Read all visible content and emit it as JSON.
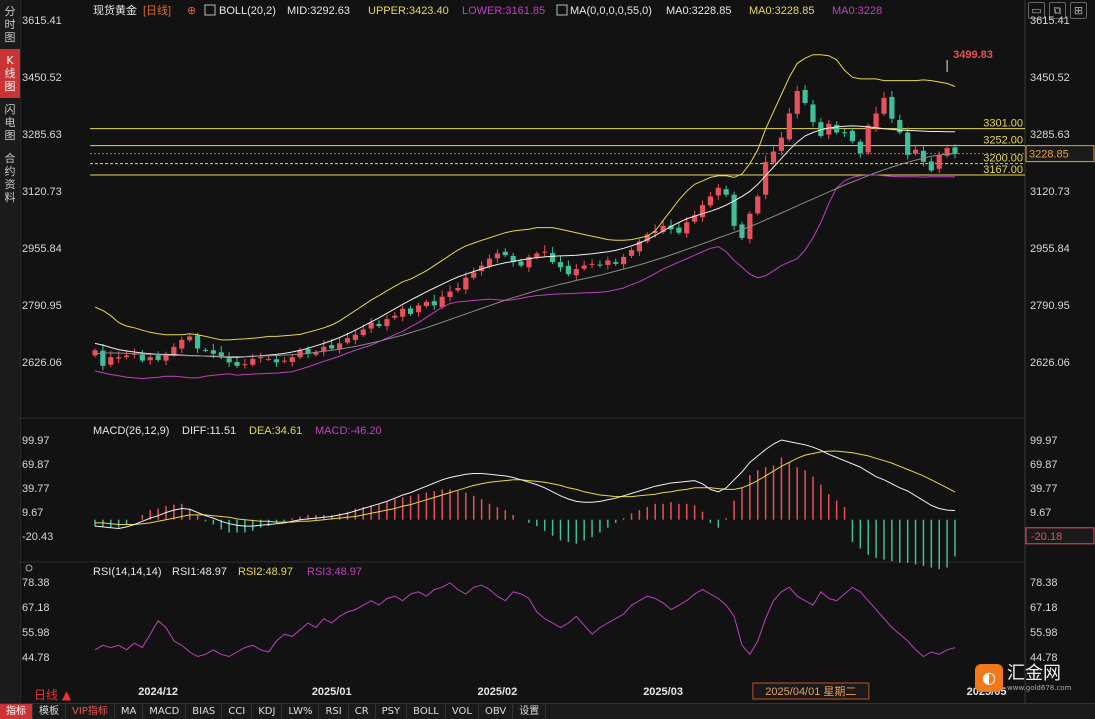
{
  "header": {
    "instrument": "现货黄金",
    "period_tag": "[日线]",
    "boll_label": "BOLL(20,2)",
    "boll_mid": "MID:3292.63",
    "boll_upper": "UPPER:3423.40",
    "boll_lower": "LOWER:3161.85",
    "ma_label": "MA(0,0,0,0,55,0)",
    "ma0_a": "MA0:3228.85",
    "ma0_b": "MA0:3228.85",
    "ma0_c": "MA0:3228"
  },
  "sidebar": {
    "tabs": [
      {
        "label": "分时图"
      },
      {
        "label": "K线图"
      },
      {
        "label": "闪电图"
      },
      {
        "label": "合约资料"
      }
    ]
  },
  "macd_header": {
    "label": "MACD(26,12,9)",
    "diff": "DIFF:11.51",
    "dea": "DEA:34.61",
    "macd": "MACD:-46.20"
  },
  "rsi_header": {
    "label": "RSI(14,14,14)",
    "rsi1": "RSI1:48.97",
    "rsi2": "RSI2:48.97",
    "rsi3": "RSI3:48.97"
  },
  "bottom": {
    "period": "日线",
    "tabs": [
      "指标",
      "模板",
      "VIP指标",
      "MA",
      "MACD",
      "BIAS",
      "CCI",
      "KDJ",
      "LW%",
      "RSI",
      "CR",
      "PSY",
      "BOLL",
      "VOL",
      "OBV",
      "设置"
    ]
  },
  "logo": {
    "name": "汇金网",
    "url": "www.gold678.com"
  },
  "colors": {
    "up": "#e8505b",
    "down": "#3fbf9a",
    "boll_mid": "#f0f0f0",
    "boll_band": "#e8d84a",
    "boll_lower": "#c040c0",
    "ma": "#8a8a8a",
    "hline": "#e8d84a"
  },
  "chart_data": [
    {
      "type": "candlestick",
      "title": "现货黄金 日线",
      "y_ticks": [
        "3615.41",
        "3450.52",
        "3285.63",
        "3120.73",
        "2955.84",
        "2790.95",
        "2626.06"
      ],
      "ylim": [
        2570,
        3640
      ],
      "x_labels": [
        "2024/12",
        "2025/01",
        "2025/02",
        "2025/03",
        "2025/05"
      ],
      "x_label_positions": [
        8,
        30,
        51,
        72,
        113
      ],
      "crosshair_label": "2025/04/01 星期二",
      "crosshair_index": 92,
      "current_price": "3228.85",
      "current_value": 3228.85,
      "high_label": "3499.83",
      "high_value": 3499.83,
      "high_index": 108,
      "levels": [
        {
          "label": "3301.00",
          "value": 3301
        },
        {
          "label": "3252.00",
          "value": 3252
        },
        {
          "label": "3200.00",
          "value": 3200
        },
        {
          "label": "3167.00",
          "value": 3167
        }
      ],
      "close": [
        2660,
        2615,
        2640,
        2640,
        2645,
        2650,
        2630,
        2640,
        2632,
        2645,
        2670,
        2690,
        2700,
        2665,
        2660,
        2650,
        2640,
        2625,
        2615,
        2620,
        2635,
        2640,
        2635,
        2625,
        2630,
        2640,
        2660,
        2650,
        2655,
        2670,
        2665,
        2680,
        2695,
        2705,
        2720,
        2740,
        2730,
        2750,
        2760,
        2780,
        2765,
        2790,
        2800,
        2790,
        2815,
        2830,
        2840,
        2870,
        2885,
        2905,
        2925,
        2940,
        2935,
        2915,
        2905,
        2930,
        2940,
        2945,
        2915,
        2900,
        2880,
        2895,
        2905,
        2910,
        2905,
        2920,
        2910,
        2930,
        2950,
        2975,
        2995,
        3005,
        3020,
        3010,
        3000,
        3030,
        3050,
        3080,
        3105,
        3130,
        3110,
        3020,
        2985,
        3055,
        3105,
        3205,
        3235,
        3275,
        3345,
        3410,
        3375,
        3320,
        3280,
        3315,
        3290,
        3290,
        3265,
        3230,
        3310,
        3345,
        3390,
        3330,
        3290,
        3225,
        3240,
        3205,
        3180,
        3225,
        3245,
        3228
      ],
      "boll_upper": [
        2785,
        2775,
        2760,
        2740,
        2730,
        2725,
        2718,
        2712,
        2708,
        2705,
        2705,
        2705,
        2708,
        2705,
        2700,
        2695,
        2690,
        2690,
        2692,
        2693,
        2695,
        2697,
        2700,
        2700,
        2702,
        2704,
        2706,
        2712,
        2718,
        2725,
        2733,
        2745,
        2760,
        2775,
        2790,
        2805,
        2818,
        2832,
        2845,
        2858,
        2866,
        2878,
        2890,
        2905,
        2920,
        2935,
        2950,
        2962,
        2970,
        2978,
        2985,
        2993,
        3000,
        3005,
        3008,
        3010,
        3015,
        3015,
        3015,
        3010,
        3005,
        3000,
        2995,
        2990,
        2985,
        2980,
        2978,
        2978,
        2980,
        2985,
        2990,
        3005,
        3035,
        3065,
        3095,
        3120,
        3140,
        3150,
        3160,
        3165,
        3165,
        3160,
        3170,
        3200,
        3240,
        3300,
        3350,
        3400,
        3450,
        3490,
        3505,
        3515,
        3515,
        3512,
        3500,
        3470,
        3450,
        3445,
        3445,
        3445,
        3440,
        3440,
        3440,
        3440,
        3440,
        3442,
        3440,
        3436,
        3432,
        3423
      ],
      "boll_mid": [
        2680,
        2675,
        2668,
        2662,
        2658,
        2655,
        2652,
        2650,
        2648,
        2648,
        2647,
        2646,
        2645,
        2644,
        2643,
        2642,
        2641,
        2640,
        2640,
        2641,
        2642,
        2644,
        2646,
        2648,
        2651,
        2655,
        2660,
        2666,
        2673,
        2680,
        2688,
        2697,
        2707,
        2718,
        2730,
        2742,
        2754,
        2767,
        2780,
        2793,
        2805,
        2817,
        2829,
        2840,
        2851,
        2862,
        2872,
        2880,
        2888,
        2895,
        2902,
        2908,
        2913,
        2917,
        2921,
        2925,
        2928,
        2930,
        2932,
        2933,
        2934,
        2935,
        2937,
        2939,
        2942,
        2945,
        2949,
        2955,
        2962,
        2970,
        2980,
        2992,
        3005,
        3018,
        3030,
        3040,
        3048,
        3055,
        3062,
        3070,
        3080,
        3092,
        3105,
        3120,
        3140,
        3165,
        3190,
        3215,
        3240,
        3262,
        3280,
        3290,
        3298,
        3303,
        3306,
        3308,
        3309,
        3308,
        3306,
        3304,
        3301,
        3299,
        3297,
        3296,
        3295,
        3294,
        3293,
        3293,
        3292,
        3292
      ],
      "boll_lower": [
        2600,
        2595,
        2590,
        2586,
        2582,
        2580,
        2578,
        2580,
        2582,
        2585,
        2585,
        2583,
        2580,
        2580,
        2585,
        2588,
        2590,
        2592,
        2588,
        2590,
        2591,
        2592,
        2593,
        2594,
        2596,
        2598,
        2605,
        2612,
        2620,
        2628,
        2635,
        2643,
        2652,
        2660,
        2668,
        2675,
        2685,
        2695,
        2705,
        2715,
        2728,
        2740,
        2755,
        2770,
        2785,
        2795,
        2800,
        2802,
        2804,
        2806,
        2808,
        2806,
        2804,
        2806,
        2810,
        2815,
        2818,
        2820,
        2822,
        2823,
        2824,
        2825,
        2826,
        2827,
        2828,
        2830,
        2835,
        2840,
        2850,
        2858,
        2870,
        2882,
        2895,
        2905,
        2915,
        2925,
        2935,
        2945,
        2955,
        2960,
        2945,
        2920,
        2900,
        2880,
        2870,
        2875,
        2890,
        2905,
        2915,
        2925,
        2950,
        2985,
        3030,
        3085,
        3130,
        3150,
        3160,
        3165,
        3167,
        3167,
        3165,
        3163,
        3162,
        3162,
        3162,
        3161,
        3162,
        3162,
        3162,
        3162
      ],
      "ma55": [
        2650,
        2652,
        2652,
        2652,
        2651,
        2650,
        2649,
        2648,
        2647,
        2646,
        2645,
        2645,
        2644,
        2644,
        2643,
        2643,
        2642,
        2642,
        2642,
        2642,
        2643,
        2643,
        2644,
        2645,
        2646,
        2647,
        2649,
        2651,
        2654,
        2657,
        2660,
        2663,
        2667,
        2671,
        2676,
        2681,
        2686,
        2692,
        2698,
        2704,
        2711,
        2718,
        2725,
        2733,
        2741,
        2749,
        2757,
        2765,
        2773,
        2781,
        2789,
        2797,
        2805,
        2812,
        2819,
        2826,
        2833,
        2839,
        2845,
        2851,
        2856,
        2862,
        2867,
        2872,
        2877,
        2883,
        2889,
        2895,
        2901,
        2907,
        2914,
        2921,
        2928,
        2936,
        2944,
        2952,
        2960,
        2968,
        2976,
        2985,
        2993,
        3001,
        3009,
        3018,
        3027,
        3037,
        3047,
        3057,
        3067,
        3078,
        3088,
        3098,
        3108,
        3118,
        3128,
        3138,
        3147,
        3156,
        3165,
        3174,
        3182,
        3190,
        3197,
        3204,
        3210,
        3216,
        3221,
        3225,
        3227,
        3229
      ]
    },
    {
      "type": "bar",
      "title": "MACD(26,12,9)",
      "y_ticks": [
        "99.97",
        "69.87",
        "39.77",
        "9.67",
        "-20.43"
      ],
      "ylim": [
        -25,
        100
      ],
      "current_value": -20.18,
      "current_label": "-20.18",
      "diff": [
        -8,
        -9,
        -10,
        -11,
        -9,
        -6,
        -2,
        2,
        5,
        9,
        12,
        14,
        13,
        9,
        5,
        2,
        -2,
        -5,
        -7,
        -8,
        -8,
        -7,
        -6,
        -5,
        -4,
        -2,
        0,
        1,
        2,
        3,
        4,
        6,
        8,
        11,
        14,
        17,
        20,
        23,
        27,
        31,
        34,
        38,
        42,
        46,
        50,
        53,
        55,
        57,
        58,
        58,
        57,
        56,
        55,
        53,
        50,
        47,
        44,
        40,
        35,
        30,
        26,
        23,
        22,
        22,
        23,
        25,
        27,
        30,
        33,
        36,
        39,
        42,
        44,
        46,
        47,
        48,
        49,
        45,
        38,
        35,
        40,
        50,
        60,
        72,
        80,
        88,
        95,
        100,
        98,
        96,
        94,
        91,
        87,
        82,
        78,
        74,
        70,
        66,
        60,
        54,
        50,
        45,
        40,
        36,
        30,
        24,
        18,
        14,
        12,
        11.5
      ],
      "dea": [
        -4,
        -4,
        -5,
        -6,
        -6,
        -6,
        -5,
        -4,
        -2,
        0,
        2,
        4,
        6,
        6,
        6,
        5,
        4,
        3,
        1,
        0,
        -1,
        -2,
        -2,
        -3,
        -3,
        -3,
        -2,
        -2,
        -1,
        0,
        1,
        2,
        3,
        4,
        6,
        8,
        10,
        12,
        14,
        17,
        19,
        22,
        25,
        28,
        31,
        34,
        37,
        40,
        43,
        45,
        47,
        48,
        49,
        50,
        50,
        49,
        48,
        47,
        45,
        43,
        40,
        38,
        35,
        33,
        31,
        30,
        29,
        29,
        29,
        30,
        31,
        32,
        34,
        35,
        37,
        38,
        40,
        40,
        40,
        39,
        38,
        38,
        40,
        44,
        49,
        55,
        61,
        67,
        72,
        77,
        81,
        83,
        85,
        86,
        86,
        85,
        84,
        82,
        80,
        77,
        74,
        71,
        67,
        63,
        59,
        55,
        50,
        45,
        40,
        34.6
      ],
      "hist": [
        -8,
        -9,
        -10,
        -10,
        -6,
        0,
        6,
        12,
        14,
        17,
        19,
        20,
        14,
        6,
        -2,
        -6,
        -12,
        -16,
        -16,
        -16,
        -14,
        -10,
        -8,
        -4,
        -2,
        2,
        4,
        6,
        6,
        6,
        6,
        8,
        10,
        14,
        16,
        18,
        20,
        22,
        26,
        28,
        30,
        32,
        34,
        36,
        38,
        38,
        36,
        34,
        30,
        26,
        20,
        16,
        12,
        6,
        0,
        -4,
        -8,
        -14,
        -20,
        -26,
        -28,
        -30,
        -26,
        -22,
        -16,
        -10,
        -4,
        2,
        8,
        12,
        16,
        20,
        20,
        22,
        20,
        20,
        18,
        10,
        -4,
        -10,
        2,
        24,
        40,
        56,
        62,
        66,
        68,
        78,
        72,
        66,
        62,
        54,
        44,
        32,
        24,
        16,
        -28,
        -36,
        -44,
        -48,
        -50,
        -52,
        -54,
        -54,
        -56,
        -58,
        -60,
        -62,
        -60,
        -46
      ]
    },
    {
      "type": "line",
      "title": "RSI(14,14,14)",
      "y_ticks": [
        "78.38",
        "67.18",
        "55.98",
        "44.78"
      ],
      "ylim": [
        42,
        80
      ],
      "values": [
        48,
        50,
        49,
        50,
        48,
        51,
        49,
        55,
        61,
        58,
        52,
        50,
        47,
        45,
        46,
        48,
        46,
        45,
        47,
        49,
        50,
        48,
        47,
        52,
        55,
        54,
        57,
        60,
        58,
        62,
        60,
        63,
        65,
        66,
        68,
        70,
        68,
        71,
        72,
        70,
        73,
        74,
        72,
        75,
        76,
        78,
        75,
        73,
        76,
        77,
        75,
        72,
        70,
        74,
        73,
        71,
        65,
        62,
        60,
        58,
        60,
        63,
        59,
        55,
        58,
        60,
        62,
        64,
        68,
        70,
        72,
        71,
        69,
        66,
        68,
        70,
        73,
        75,
        73,
        71,
        68,
        63,
        50,
        46,
        52,
        62,
        70,
        74,
        76,
        72,
        70,
        68,
        74,
        71,
        70,
        73,
        76,
        74,
        70,
        66,
        62,
        58,
        55,
        52,
        48,
        45,
        47,
        46,
        48,
        49
      ]
    }
  ]
}
